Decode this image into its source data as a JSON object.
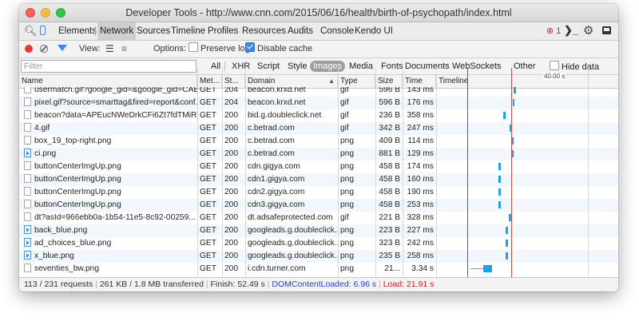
{
  "window": {
    "title": "Developer Tools - http://www.cnn.com/2015/06/16/health/birth-of-psychopath/index.html"
  },
  "tabs": [
    {
      "label": "Elements",
      "active": false
    },
    {
      "label": "Network",
      "active": true
    },
    {
      "label": "Sources",
      "active": false
    },
    {
      "label": "Timeline",
      "active": false
    },
    {
      "label": "Profiles",
      "active": false
    },
    {
      "label": "Resources",
      "active": false
    },
    {
      "label": "Audits",
      "active": false
    },
    {
      "label": "Console",
      "active": false
    },
    {
      "label": "Kendo UI",
      "active": false
    }
  ],
  "error_count": "1",
  "toolbar": {
    "view_label": "View:",
    "options_label": "Options:",
    "preserve_log": "Preserve log",
    "disable_cache": "Disable cache"
  },
  "filter": {
    "placeholder": "Filter",
    "types": [
      "All",
      "XHR",
      "Script",
      "Style",
      "Images",
      "Media",
      "Fonts",
      "Documents",
      "WebSockets",
      "Other"
    ],
    "active_type": "Images",
    "hide_data_urls": "Hide data URLs"
  },
  "columns": {
    "name": "Name",
    "method": "Met...",
    "status": "St...",
    "domain": "Domain",
    "type": "Type",
    "size": "Size",
    "time": "Time",
    "timeline": "Timeline"
  },
  "timeline_tick": "40.00 s",
  "rows": [
    {
      "name": "usermatch.gif?google_gid=&google_gid=CAE...",
      "method": "GET",
      "status": "204",
      "domain": "beacon.krxd.net",
      "type": "gif",
      "size": "596 B",
      "time": "143 ms",
      "icon": "file-icon"
    },
    {
      "name": "pixel.gif?source=smarttag&fired=report&conf...",
      "method": "GET",
      "status": "204",
      "domain": "beacon.krxd.net",
      "type": "gif",
      "size": "596 B",
      "time": "176 ms",
      "icon": "file-icon"
    },
    {
      "name": "beacon?data=APEucNWeDrkCFi6Zt7fdTMiRO...",
      "method": "GET",
      "status": "200",
      "domain": "bid.g.doubleclick.net",
      "type": "gif",
      "size": "236 B",
      "time": "358 ms",
      "icon": "file-icon"
    },
    {
      "name": "4.gif",
      "method": "GET",
      "status": "200",
      "domain": "c.betrad.com",
      "type": "gif",
      "size": "342 B",
      "time": "247 ms",
      "icon": "file-icon"
    },
    {
      "name": "box_19_top-right.png",
      "method": "GET",
      "status": "200",
      "domain": "c.betrad.com",
      "type": "png",
      "size": "409 B",
      "time": "114 ms",
      "icon": "file-icon"
    },
    {
      "name": "ci.png",
      "method": "GET",
      "status": "200",
      "domain": "c.betrad.com",
      "type": "png",
      "size": "881 B",
      "time": "129 ms",
      "icon": "play-file-icon"
    },
    {
      "name": "buttonCenterImgUp.png",
      "method": "GET",
      "status": "200",
      "domain": "cdn.gigya.com",
      "type": "png",
      "size": "458 B",
      "time": "174 ms",
      "icon": "file-icon"
    },
    {
      "name": "buttonCenterImgUp.png",
      "method": "GET",
      "status": "200",
      "domain": "cdn1.gigya.com",
      "type": "png",
      "size": "458 B",
      "time": "160 ms",
      "icon": "file-icon"
    },
    {
      "name": "buttonCenterImgUp.png",
      "method": "GET",
      "status": "200",
      "domain": "cdn2.gigya.com",
      "type": "png",
      "size": "458 B",
      "time": "190 ms",
      "icon": "file-icon"
    },
    {
      "name": "buttonCenterImgUp.png",
      "method": "GET",
      "status": "200",
      "domain": "cdn3.gigya.com",
      "type": "png",
      "size": "458 B",
      "time": "253 ms",
      "icon": "file-icon"
    },
    {
      "name": "dt?asId=966ebb0a-1b54-11e5-8c92-00259...",
      "method": "GET",
      "status": "200",
      "domain": "dt.adsafeprotected.com",
      "type": "gif",
      "size": "221 B",
      "time": "328 ms",
      "icon": "file-icon"
    },
    {
      "name": "back_blue.png",
      "method": "GET",
      "status": "200",
      "domain": "googleads.g.doubleclick...",
      "type": "png",
      "size": "223 B",
      "time": "227 ms",
      "icon": "back-file-icon"
    },
    {
      "name": "ad_choices_blue.png",
      "method": "GET",
      "status": "200",
      "domain": "googleads.g.doubleclick...",
      "type": "png",
      "size": "323 B",
      "time": "242 ms",
      "icon": "play-file-icon"
    },
    {
      "name": "x_blue.png",
      "method": "GET",
      "status": "200",
      "domain": "googleads.g.doubleclick...",
      "type": "png",
      "size": "235 B",
      "time": "258 ms",
      "icon": "x-file-icon"
    },
    {
      "name": "seventies_bw.png",
      "method": "GET",
      "status": "200",
      "domain": "i.cdn.turner.com",
      "type": "png",
      "size": "21...",
      "time": "3.34 s",
      "icon": "file-icon"
    }
  ],
  "status": {
    "requests": "113 / 231 requests",
    "transferred": "261 KB / 1.8 MB transferred",
    "finish": "Finish: 52.49 s",
    "dcl": "DOMContentLoaded: 6.96 s",
    "load": "Load: 21.91 s"
  }
}
